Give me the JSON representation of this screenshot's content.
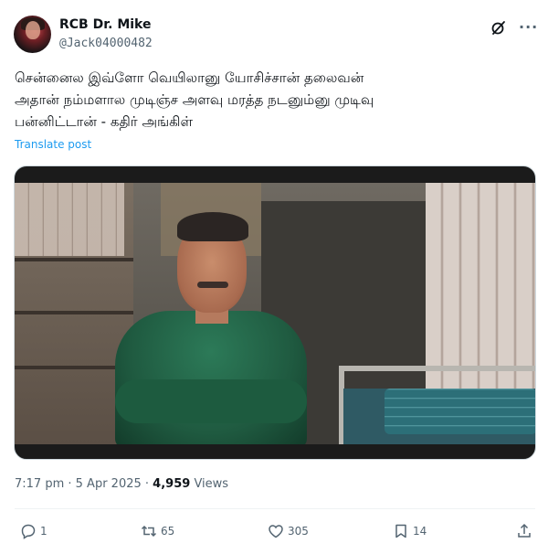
{
  "author": {
    "display_name": "RCB Dr. Mike",
    "handle": "@Jack04000482"
  },
  "tweet": {
    "text_line1": "சென்னைல இவ்ளோ வெயிலானு யோசிச்சான் தலைவன்",
    "text_line2": "அதான் நம்மளால முடிஞ்ச அளவு மரத்த நடனும்னு முடிவு",
    "text_line3": "பன்னிட்டான் - கதிர் அங்கிள்",
    "translate_label": "Translate post"
  },
  "meta": {
    "time": "7:17 pm",
    "date": "5 Apr 2025",
    "views_count": "4,959",
    "views_label": "Views"
  },
  "actions": {
    "replies": "1",
    "reposts": "65",
    "likes": "305",
    "bookmarks": "14"
  },
  "icons": [
    "grok-icon",
    "more-icon",
    "reply-icon",
    "repost-icon",
    "like-icon",
    "bookmark-icon",
    "share-icon"
  ],
  "colors": {
    "link": "#1d9bf0",
    "secondary_text": "#536471",
    "primary_text": "#0f1419"
  }
}
